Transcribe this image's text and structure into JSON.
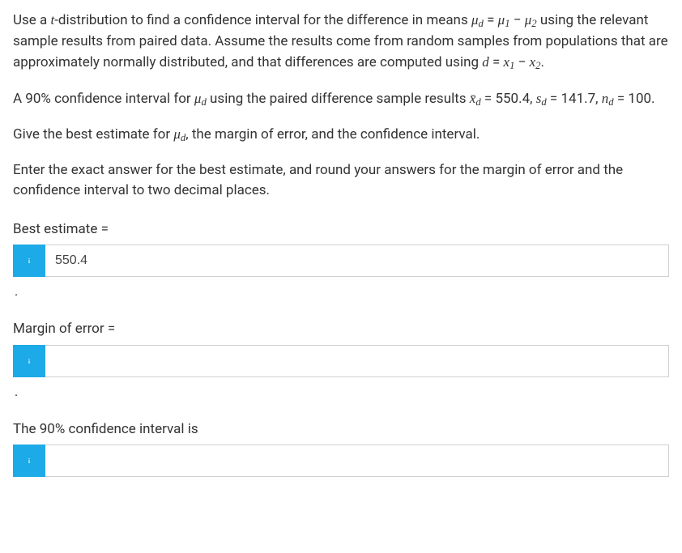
{
  "intro": {
    "part1": "Use a ",
    "t": "t",
    "part2": "-distribution to find a confidence interval for the difference in means ",
    "eq1_lhs": "μ",
    "eq1_sub": "d",
    "eq1_eq": " = ",
    "eq1_mu1": "μ",
    "eq1_s1": "1",
    "eq1_minus": " − ",
    "eq1_mu2": "μ",
    "eq1_s2": "2",
    "part3": " using the relevant sample results from paired data. Assume the results come from random samples from populations that are approximately normally distributed, and that differences are computed using ",
    "eq2_d": "d",
    "eq2_eq": " = ",
    "eq2_x1": "x",
    "eq2_s1": "1",
    "eq2_minus": " − ",
    "eq2_x2": "x",
    "eq2_s2": "2",
    "period": "."
  },
  "stmt": {
    "part1": "A 90% confidence interval for ",
    "mu": "μ",
    "mu_sub": "d",
    "part2": " using the paired difference sample results ",
    "xbar": "x̄",
    "xbar_sub": "d",
    "eq1": " = 550.4, ",
    "s": "s",
    "s_sub": "d",
    "eq2": " = 141.7, ",
    "n": "n",
    "n_sub": "d",
    "eq3": " = 100."
  },
  "ask": {
    "part1": "Give the best estimate for ",
    "mu": "μ",
    "mu_sub": "d",
    "part2": ", the margin of error, and the confidence interval."
  },
  "instr": "Enter the exact answer for the best estimate, and round your answers for the margin of error and the confidence interval to two decimal places.",
  "labels": {
    "best_estimate": "Best estimate =",
    "margin_of_error": "Margin of error =",
    "ci": "The 90% confidence interval is"
  },
  "inputs": {
    "best_estimate": "550.4",
    "margin_of_error": "",
    "ci_lower": ""
  },
  "period": "."
}
